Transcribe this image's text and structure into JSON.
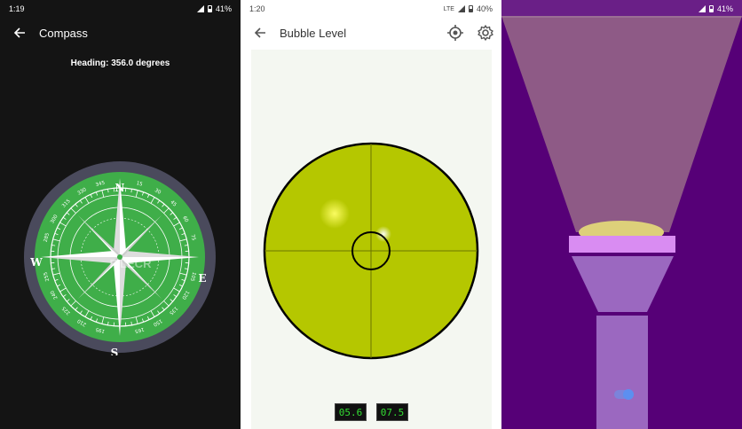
{
  "compass_screen": {
    "status": {
      "time": "1:19",
      "battery": "41%"
    },
    "title": "Compass",
    "heading_text": "Heading: 356.0 degrees",
    "cardinals": {
      "n": "N",
      "e": "E",
      "s": "S",
      "w": "W"
    },
    "degree_labels": [
      "345",
      "15",
      "30",
      "45",
      "60",
      "75",
      "105",
      "120",
      "135",
      "150",
      "165",
      "195",
      "210",
      "225",
      "240",
      "255",
      "285",
      "300",
      "315",
      "330"
    ],
    "watermark": "FILECR",
    "colors": {
      "bezel": "#4a4a5c",
      "dial": "#3fae49",
      "background": "#141414"
    }
  },
  "level_screen": {
    "status": {
      "time": "1:20",
      "network": "LTE",
      "battery": "40%"
    },
    "title": "Bubble Level",
    "readouts": {
      "x": "05.6",
      "y": "07.5"
    },
    "colors": {
      "disc": "#b5c700",
      "readout_text": "#33dd33"
    }
  },
  "flashlight_screen": {
    "status": {
      "battery": "41%"
    },
    "colors": {
      "background": "#560077",
      "beam": "#8e5a86",
      "lens": "#ddd07a",
      "head": "#d98cf2",
      "body": "#9b68c0"
    }
  }
}
